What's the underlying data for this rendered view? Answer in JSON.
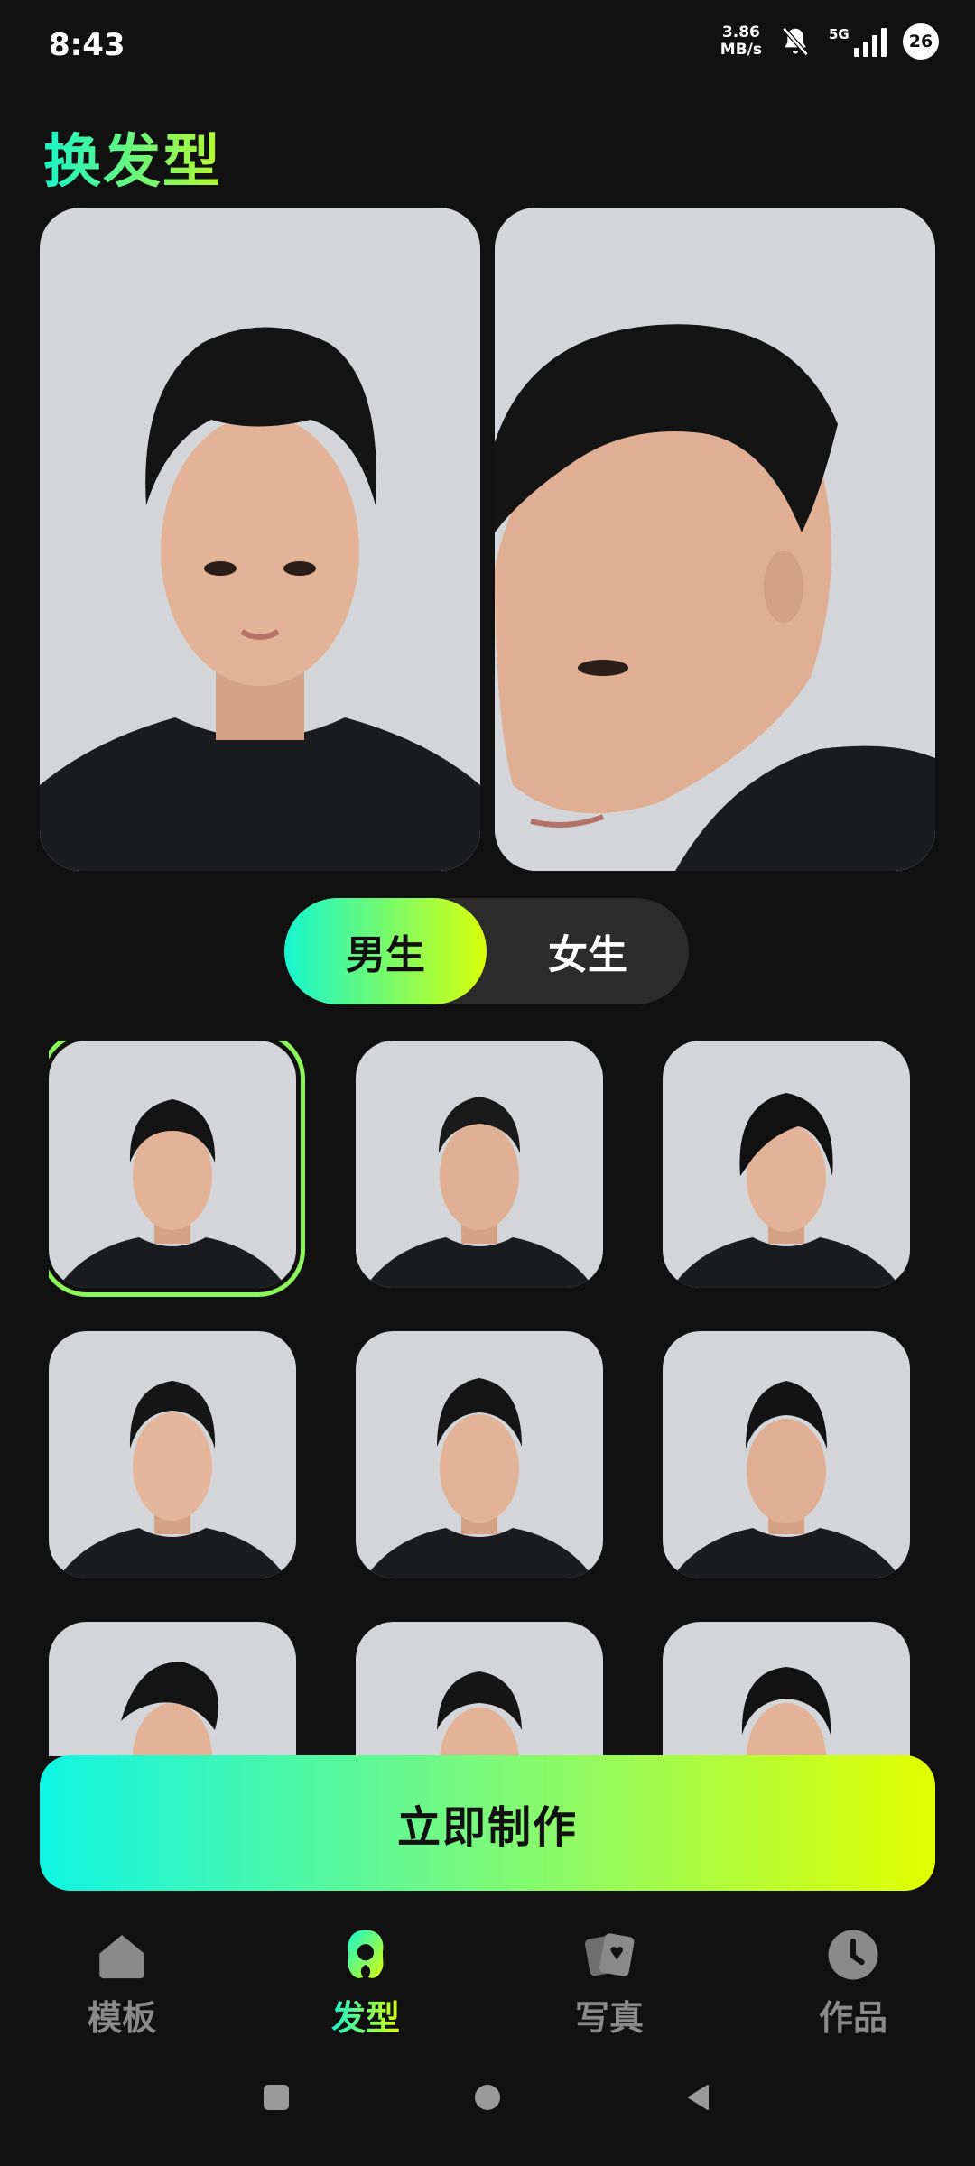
{
  "status_bar": {
    "time": "8:43",
    "net_speed_value": "3.86",
    "net_speed_unit": "MB/s",
    "network_type": "5G",
    "battery": "26"
  },
  "page": {
    "title": "换发型"
  },
  "gender_toggle": {
    "options": [
      "男生",
      "女生"
    ],
    "selected": "男生"
  },
  "hairstyle_grid": {
    "selected_index": 0,
    "tiles": 9
  },
  "actions": {
    "make_label": "立即制作"
  },
  "bottom_nav": {
    "items": [
      {
        "label": "模板",
        "icon": "home-icon"
      },
      {
        "label": "发型",
        "icon": "hairstyle-icon"
      },
      {
        "label": "写真",
        "icon": "photo-cards-icon"
      },
      {
        "label": "作品",
        "icon": "clock-icon"
      }
    ],
    "active": "发型"
  },
  "colors": {
    "background": "#111111",
    "accent_start": "#14f6d0",
    "accent_end": "#d9ff0a",
    "inactive_nav": "#8a8a8a"
  }
}
